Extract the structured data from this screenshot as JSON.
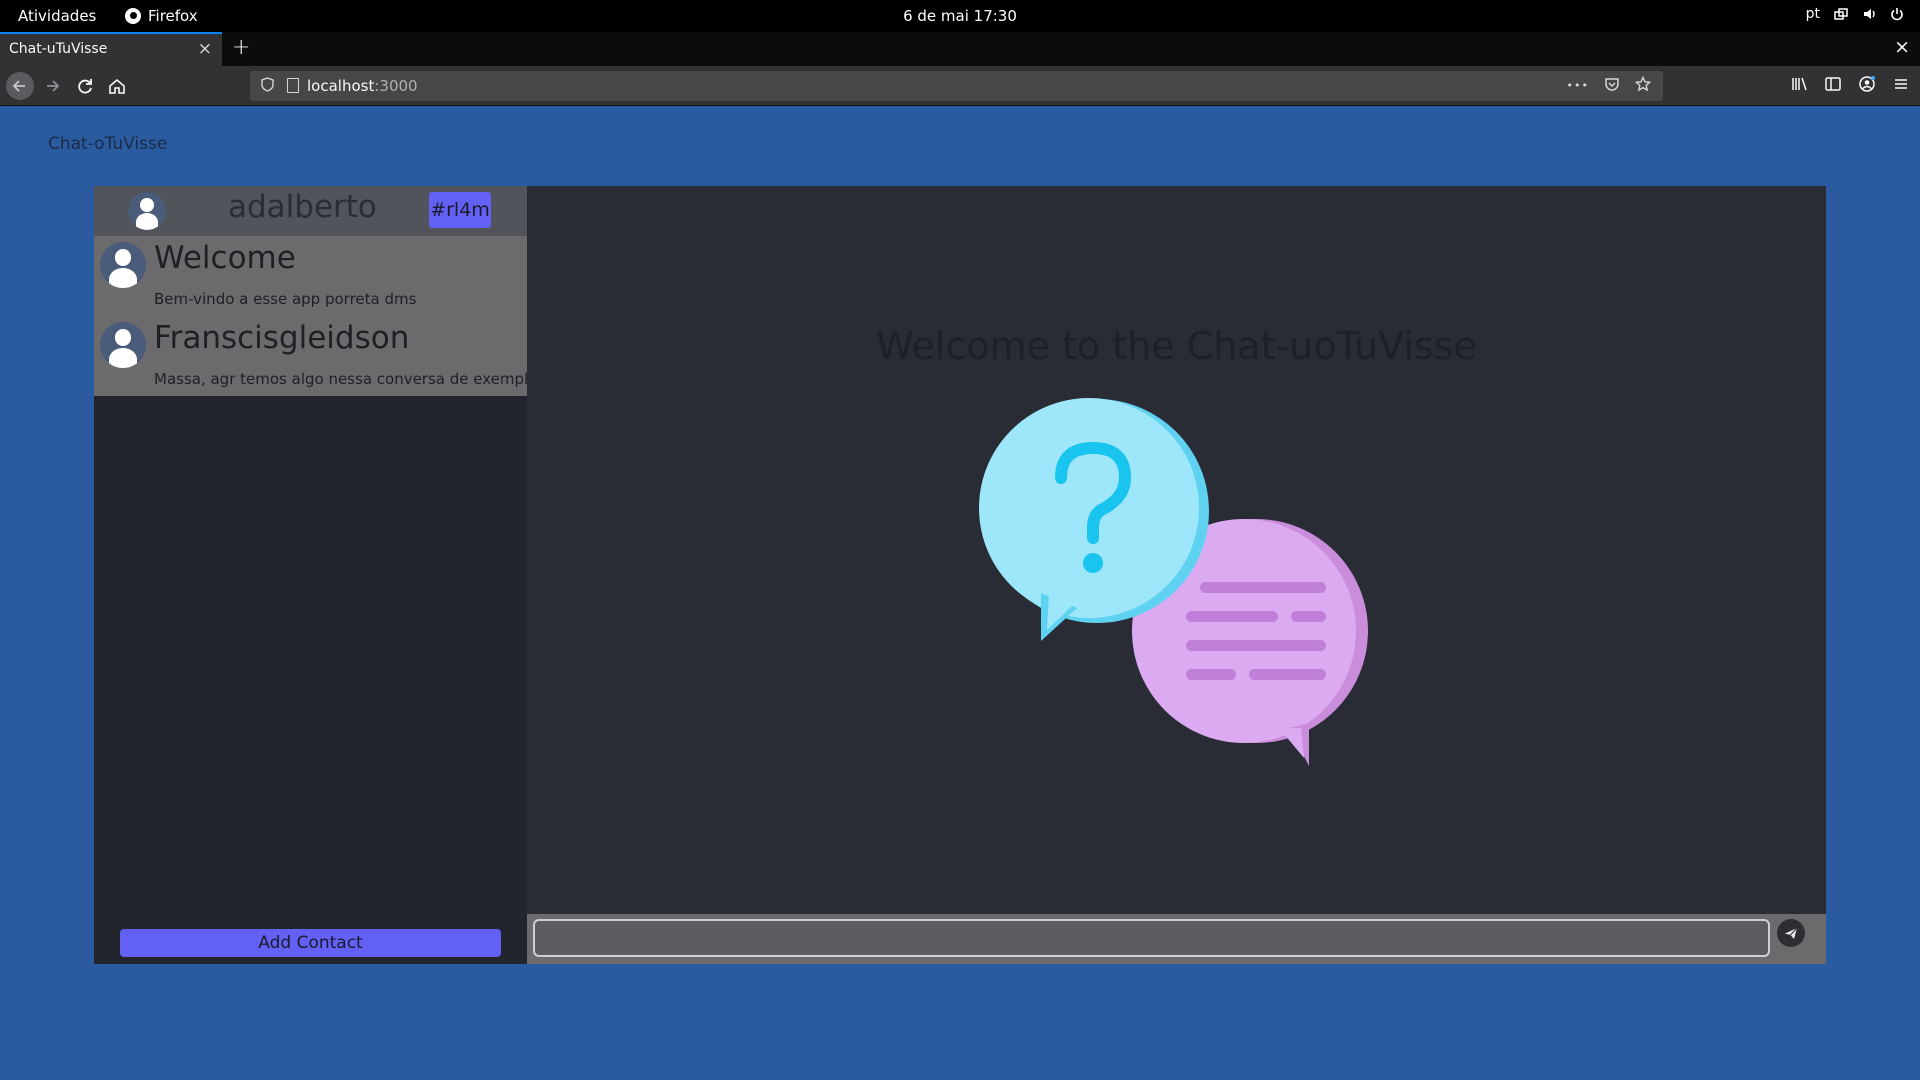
{
  "os_bar": {
    "activities": "Atividades",
    "app_name": "Firefox",
    "clock": "6 de mai  17:30",
    "keyboard_layout": "pt",
    "icons": [
      "network-icon",
      "volume-icon",
      "power-icon"
    ]
  },
  "browser": {
    "tab_title": "Chat-uTuVisse",
    "tab_close": "×",
    "new_tab": "+",
    "window_close": "×",
    "url_host": "localhost",
    "url_port": ":3000",
    "url_actions_more": "•••",
    "nav_icons": [
      "back-icon",
      "forward-icon",
      "reload-icon",
      "home-icon"
    ],
    "toolbar_icons": [
      "library-icon",
      "sidebar-icon",
      "account-icon",
      "menu-icon"
    ],
    "accent": "#0a84ff"
  },
  "page": {
    "title": "Chat-oTuVisse",
    "background": "#2a5ba1"
  },
  "sidebar": {
    "user": {
      "name": "adalberto",
      "code": "#rl4m"
    },
    "contacts": [
      {
        "name": "Welcome",
        "last_message": "Bem-vindo a esse app porreta dms"
      },
      {
        "name": "Franscisgleidson",
        "last_message": "Massa, agr temos algo nessa conversa de exemplo"
      }
    ],
    "add_contact_label": "Add Contact",
    "accent": "#6360f5"
  },
  "chat": {
    "welcome_text": "Welcome to the Chat-uoTuVisse",
    "message_input": {
      "value": "",
      "placeholder": ""
    },
    "send_icon": "send-icon"
  }
}
